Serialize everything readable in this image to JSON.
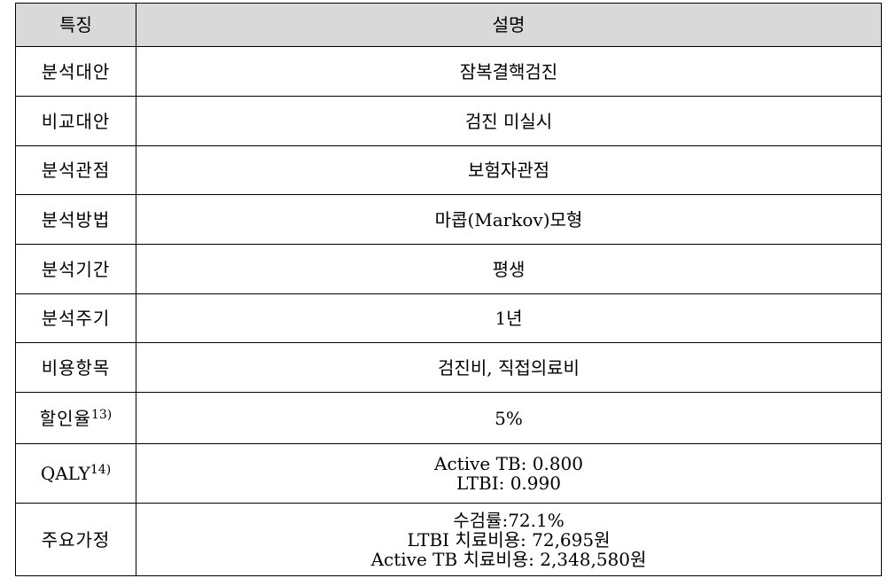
{
  "table": {
    "headers": {
      "feature": "특징",
      "description": "설명"
    },
    "rows": [
      {
        "feature": "분석대안",
        "feature_sup": "",
        "description": [
          "잠복결핵검진"
        ]
      },
      {
        "feature": "비교대안",
        "feature_sup": "",
        "description": [
          "검진 미실시"
        ]
      },
      {
        "feature": "분석관점",
        "feature_sup": "",
        "description": [
          "보험자관점"
        ]
      },
      {
        "feature": "분석방법",
        "feature_sup": "",
        "description": [
          "마콥(Markov)모형"
        ]
      },
      {
        "feature": "분석기간",
        "feature_sup": "",
        "description": [
          "평생"
        ]
      },
      {
        "feature": "분석주기",
        "feature_sup": "",
        "description": [
          "1년"
        ]
      },
      {
        "feature": "비용항목",
        "feature_sup": "",
        "description": [
          "검진비, 직접의료비"
        ]
      },
      {
        "feature": "할인율",
        "feature_sup": "13)",
        "description": [
          "5%"
        ]
      },
      {
        "feature": "QALY",
        "feature_sup": "14)",
        "description": [
          "Active TB: 0.800",
          "LTBI: 0.990"
        ]
      },
      {
        "feature": "주요가정",
        "feature_sup": "",
        "description": [
          "수검률:72.1%",
          "LTBI 치료비용: 72,695원",
          "Active TB 치료비용: 2,348,580원"
        ]
      }
    ]
  }
}
